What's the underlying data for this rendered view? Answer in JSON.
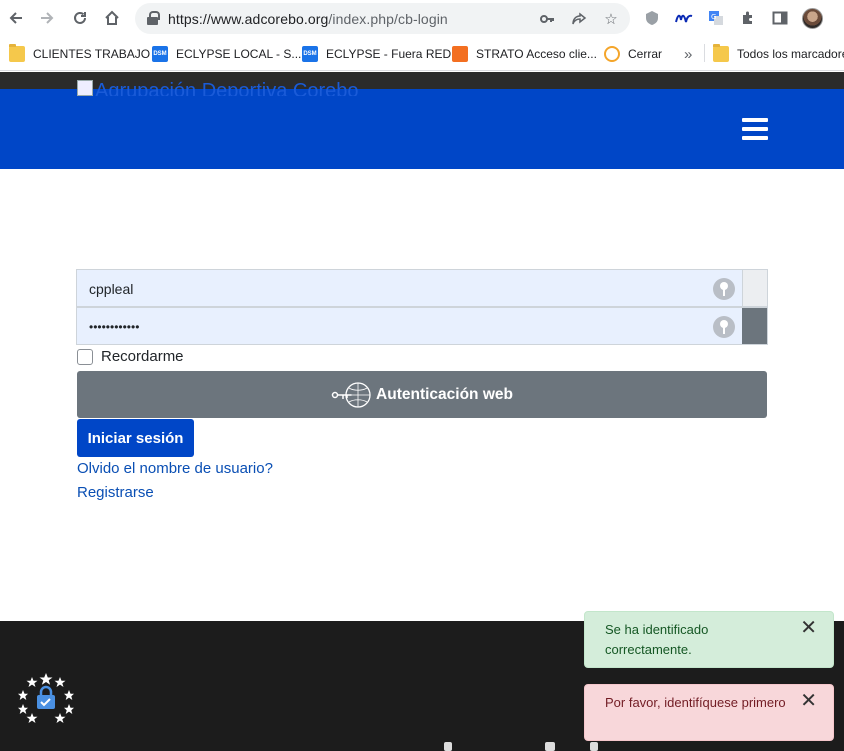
{
  "browser": {
    "url_host": "https://www.adcorebo.org",
    "url_path": "/index.php/cb-login",
    "bookmarks": [
      {
        "label": "CLIENTES TRABAJO",
        "icon": "folder-icon"
      },
      {
        "label": "ECLYPSE LOCAL - S...",
        "icon": "dsm-icon",
        "icon_text": "DSM"
      },
      {
        "label": "ECLYPSE - Fuera RED",
        "icon": "dsm-icon",
        "icon_text": "DSM"
      },
      {
        "label": "STRATO Acceso clie...",
        "icon": "strato-icon"
      },
      {
        "label": "Cerrar",
        "icon": "cerrar-icon"
      }
    ],
    "overflow_label": "»",
    "all_bookmarks_label": "Todos los marcadores"
  },
  "header": {
    "logo_alt": "Agrupación Deportiva Corebo"
  },
  "login": {
    "username_value": "cppleal",
    "password_value": "••••••••••••",
    "remember_label": "Recordarme",
    "webauth_label": "Autenticación web",
    "submit_label": "Iniciar sesión",
    "forgot_label": "Olvido el nombre de usuario?",
    "register_label": "Registrarse"
  },
  "toasts": {
    "success_text": "Se ha identificado correctamente.",
    "error_text": "Por favor, identifíquese primero",
    "close_glyph": "✕"
  },
  "colors": {
    "brand_blue": "#0046c7",
    "footer_dark": "#1c1c1c",
    "success_bg": "#d4edda",
    "error_bg": "#f8d7da"
  }
}
